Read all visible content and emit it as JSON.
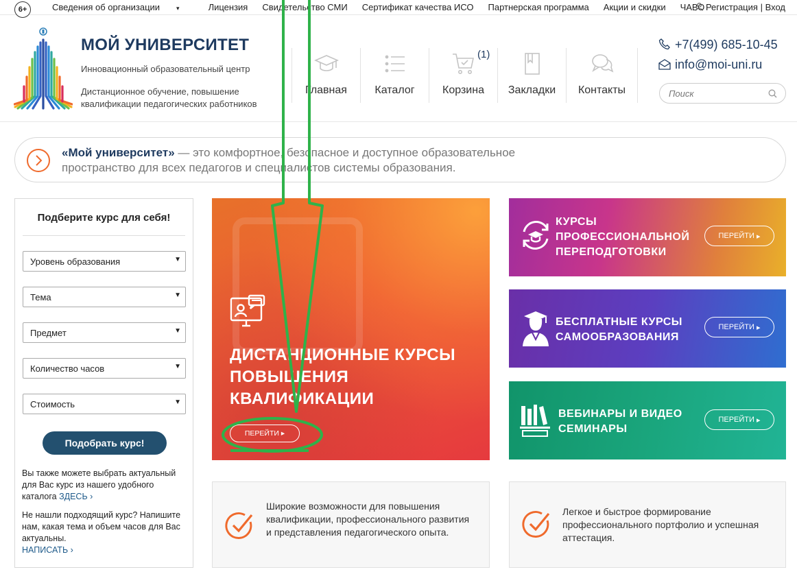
{
  "topbar": {
    "age_badge": "6+",
    "links": [
      "Сведения об организации",
      "Лицензия",
      "Свидетельство СМИ",
      "Сертификат качества ИСО",
      "Партнерская программа",
      "Акции и скидки",
      "ЧАВО"
    ],
    "dropdown_caret": "▾",
    "register": "Регистрация",
    "divider": "|",
    "login": "Вход"
  },
  "header": {
    "title": "МОЙ УНИВЕРСИТЕТ",
    "subtitle": "Инновационный образовательный центр",
    "description": "Дистанционное обучение, повышение квалификации педагогических работников",
    "nav": [
      {
        "label": "Главная",
        "icon": "graduation-cap-icon"
      },
      {
        "label": "Каталог",
        "icon": "list-icon"
      },
      {
        "label": "Корзина",
        "icon": "cart-icon",
        "badge": "(1)"
      },
      {
        "label": "Закладки",
        "icon": "bookmark-icon"
      },
      {
        "label": "Контакты",
        "icon": "chat-icon"
      }
    ],
    "phone": "+7(499) 685-10-45",
    "email": "info@moi-uni.ru",
    "search_placeholder": "Поиск"
  },
  "banner": {
    "brand": "«Мой университет»",
    "text": " — это комфортное, безопасное и доступное образовательное пространство для всех педагогов и специалистов системы образования."
  },
  "filter": {
    "title": "Подберите курс для себя!",
    "selects": [
      "Уровень образования",
      "Тема",
      "Предмет",
      "Количество часов",
      "Стоимость"
    ],
    "submit": "Подобрать курс!",
    "note1": "Вы также можете выбрать актуальный для Вас курс из нашего удобного каталога ",
    "note1_link": "ЗДЕСЬ",
    "note2": "Не нашли подходящий курс? Напишите нам, какая тема и объем часов для Вас актуальны.",
    "note2_link": "НАПИСАТЬ",
    "link_arrow": "›"
  },
  "tiles": {
    "main": {
      "title": "ДИСТАНЦИОННЫЕ КУРСЫ ПОВЫШЕНИЯ КВАЛИФИКАЦИИ",
      "button": "ПЕРЕЙТИ"
    },
    "retraining": {
      "title": "КУРСЫ ПРОФЕССИОНАЛЬНОЙ ПЕРЕПОДГОТОВКИ",
      "button": "ПЕРЕЙТИ"
    },
    "free": {
      "title": "БЕСПЛАТНЫЕ КУРСЫ САМООБРАЗОВАНИЯ",
      "button": "ПЕРЕЙТИ"
    },
    "webinars": {
      "title": "ВЕБИНАРЫ И ВИДЕО СЕМИНАРЫ",
      "button": "ПЕРЕЙТИ"
    },
    "button_arrow": "▸"
  },
  "features": [
    "Широкие возможности для повышения квалификации, профессионального развития и представления педагогического опыта.",
    "Легкое и быстрое формирование профессионального портфолио и успешная аттестация."
  ],
  "colors": {
    "brand_navy": "#1e3a5f",
    "accent_orange": "#ef6a2c",
    "annotation_green": "#2fb24a"
  }
}
